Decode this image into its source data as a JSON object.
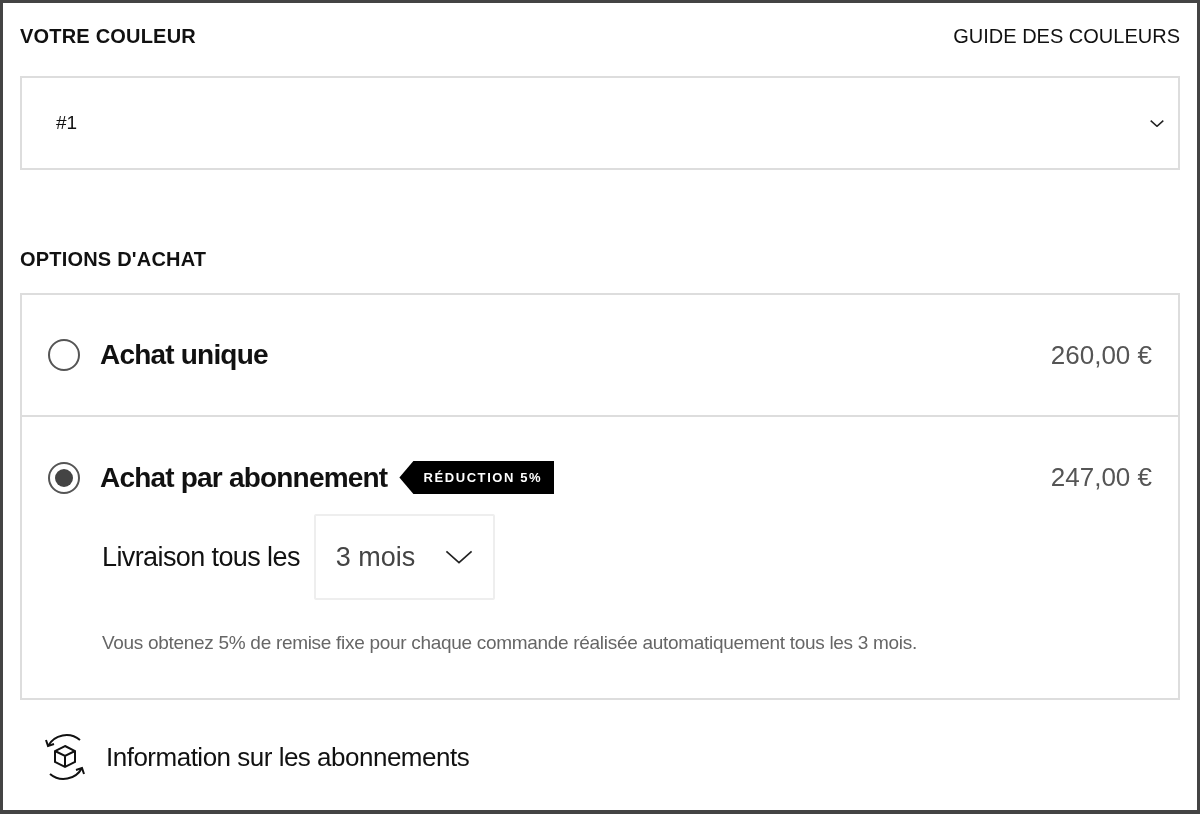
{
  "color_section": {
    "title": "VOTRE COULEUR",
    "guide_link": "GUIDE DES COULEURS",
    "select_value": "#1"
  },
  "purchase_section": {
    "title": "OPTIONS D'ACHAT",
    "options": [
      {
        "label": "Achat unique",
        "price": "260,00 €",
        "selected": false
      },
      {
        "label": "Achat par abonnement",
        "price": "247,00 €",
        "selected": true,
        "badge": "RÉDUCTION 5%",
        "delivery_label": "Livraison tous les",
        "delivery_value": "3 mois",
        "note": "Vous obtenez 5% de remise fixe pour chaque commande réalisée automatiquement tous les 3 mois."
      }
    ]
  },
  "info_link": "Information sur les abonnements"
}
